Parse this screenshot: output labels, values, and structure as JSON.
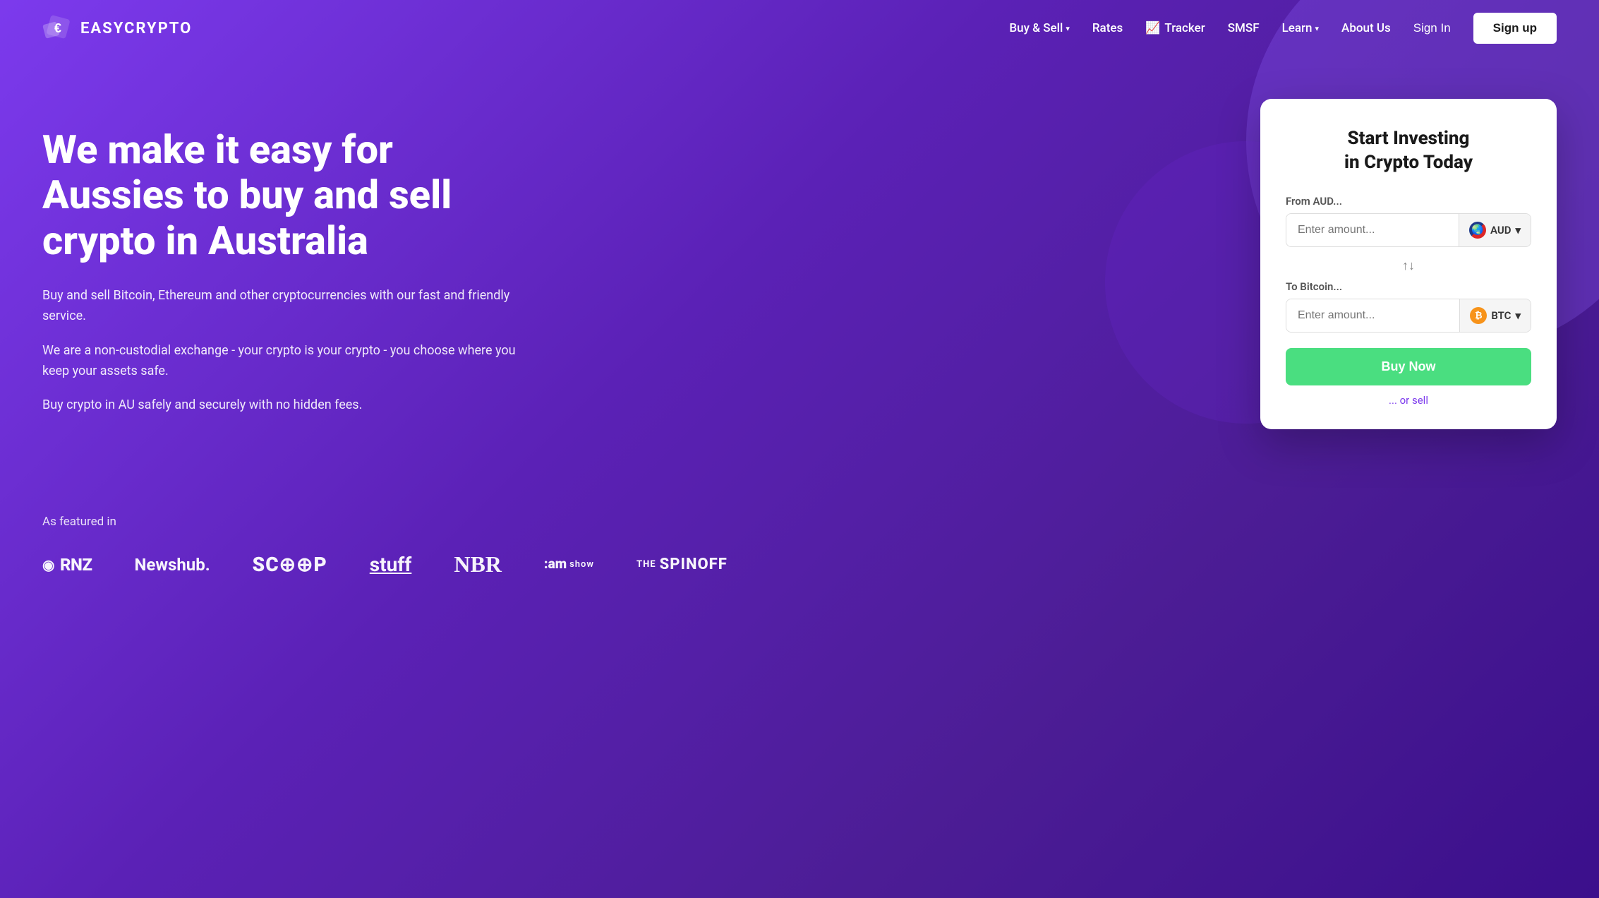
{
  "brand": {
    "name": "EASYCRYPTO",
    "logo_alt": "EasyCrypto Logo"
  },
  "nav": {
    "items": [
      {
        "id": "buy-sell",
        "label": "Buy & Sell",
        "has_dropdown": true
      },
      {
        "id": "rates",
        "label": "Rates",
        "has_dropdown": false
      },
      {
        "id": "tracker",
        "label": "Tracker",
        "has_dropdown": false,
        "has_icon": true
      },
      {
        "id": "smsf",
        "label": "SMSF",
        "has_dropdown": false
      },
      {
        "id": "learn",
        "label": "Learn",
        "has_dropdown": true
      },
      {
        "id": "about-us",
        "label": "About Us",
        "has_dropdown": false
      },
      {
        "id": "sign-in",
        "label": "Sign In",
        "is_signin": true
      }
    ],
    "signup_label": "Sign up"
  },
  "hero": {
    "title": "We make it easy for Aussies to buy and sell crypto in Australia",
    "desc1": "Buy and sell Bitcoin, Ethereum and other cryptocurrencies with our fast and friendly service.",
    "desc2": "We are a non-custodial exchange - your crypto is your crypto - you choose where you keep your assets safe.",
    "desc3": "Buy crypto in AU safely and securely with no hidden fees."
  },
  "invest_card": {
    "title": "Start Investing\nin Crypto Today",
    "from_label": "From AUD...",
    "from_placeholder": "Enter amount...",
    "from_currency": "AUD",
    "swap_icon": "↑↓",
    "to_label": "To Bitcoin...",
    "to_placeholder": "Enter amount...",
    "to_currency": "BTC",
    "buy_now_label": "Buy Now",
    "or_sell_label": "... or sell"
  },
  "featured": {
    "label": "As featured in",
    "logos": [
      {
        "id": "rnz",
        "text": "RNZ",
        "prefix": "◎"
      },
      {
        "id": "newshub",
        "text": "Newshub."
      },
      {
        "id": "scoop",
        "text": "SCOOP"
      },
      {
        "id": "stuff",
        "text": "stuff"
      },
      {
        "id": "nbr",
        "text": "NBR"
      },
      {
        "id": "am-show",
        "text": ":am\nshow"
      },
      {
        "id": "spinoff",
        "text": "THE SPINOFF"
      }
    ]
  }
}
